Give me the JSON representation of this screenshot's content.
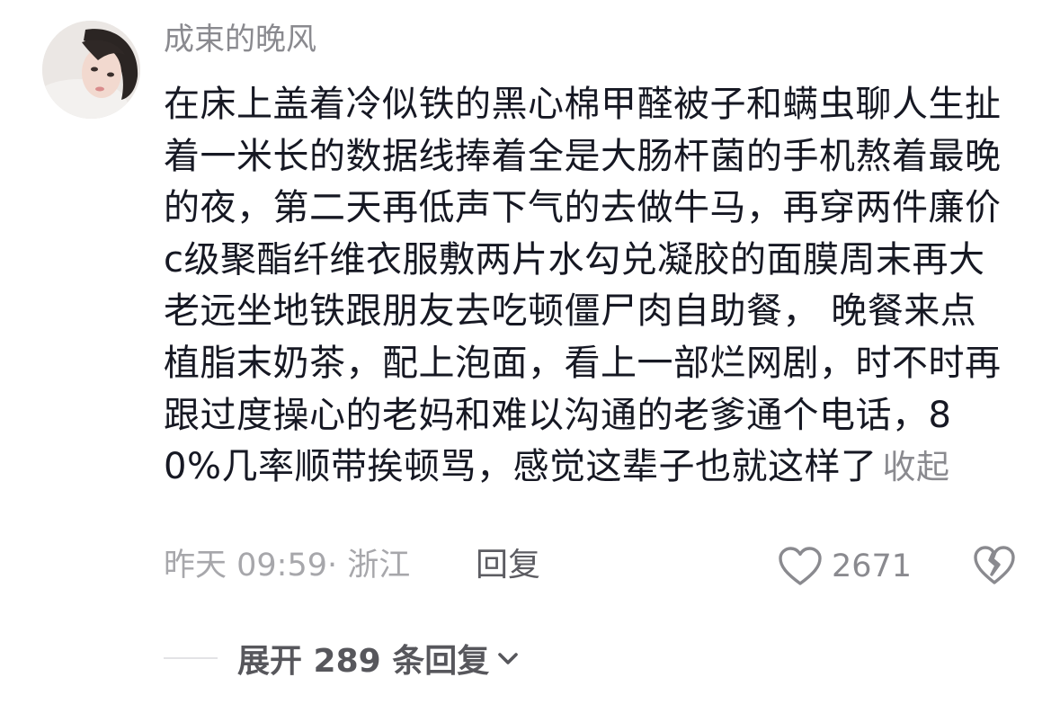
{
  "comment": {
    "username": "成束的晚风",
    "text": "在床上盖着冷似铁的黑心棉甲醛被子和螨虫聊人生扯着一米长的数据线捧着全是大肠杆菌的手机熬着最晚的夜，第二天再低声下气的去做牛马，再穿两件廉价c级聚酯纤维衣服敷两片水勾兑凝胶的面膜周末再大老远坐地铁跟朋友去吃顿僵尸肉自助餐， 晚餐来点植脂末奶茶，配上泡面，看上一部烂网剧，时不时再跟过度操心的老妈和难以沟通的老爹通个电话，80%几率顺带挨顿骂，感觉这辈子也就这样了",
    "collapse_label": "收起",
    "meta": "昨天 09:59· 浙江",
    "reply_label": "回复",
    "like_count": "2671",
    "expand_label": "展开 289 条回复"
  },
  "icons": {
    "like": "heart-outline-icon",
    "dislike": "broken-heart-icon",
    "expand": "chevron-down-icon"
  },
  "colors": {
    "text": "#161823",
    "secondary": "#8a8a8f",
    "meta": "#a7a7ab",
    "icon": "#8a8a8f"
  }
}
